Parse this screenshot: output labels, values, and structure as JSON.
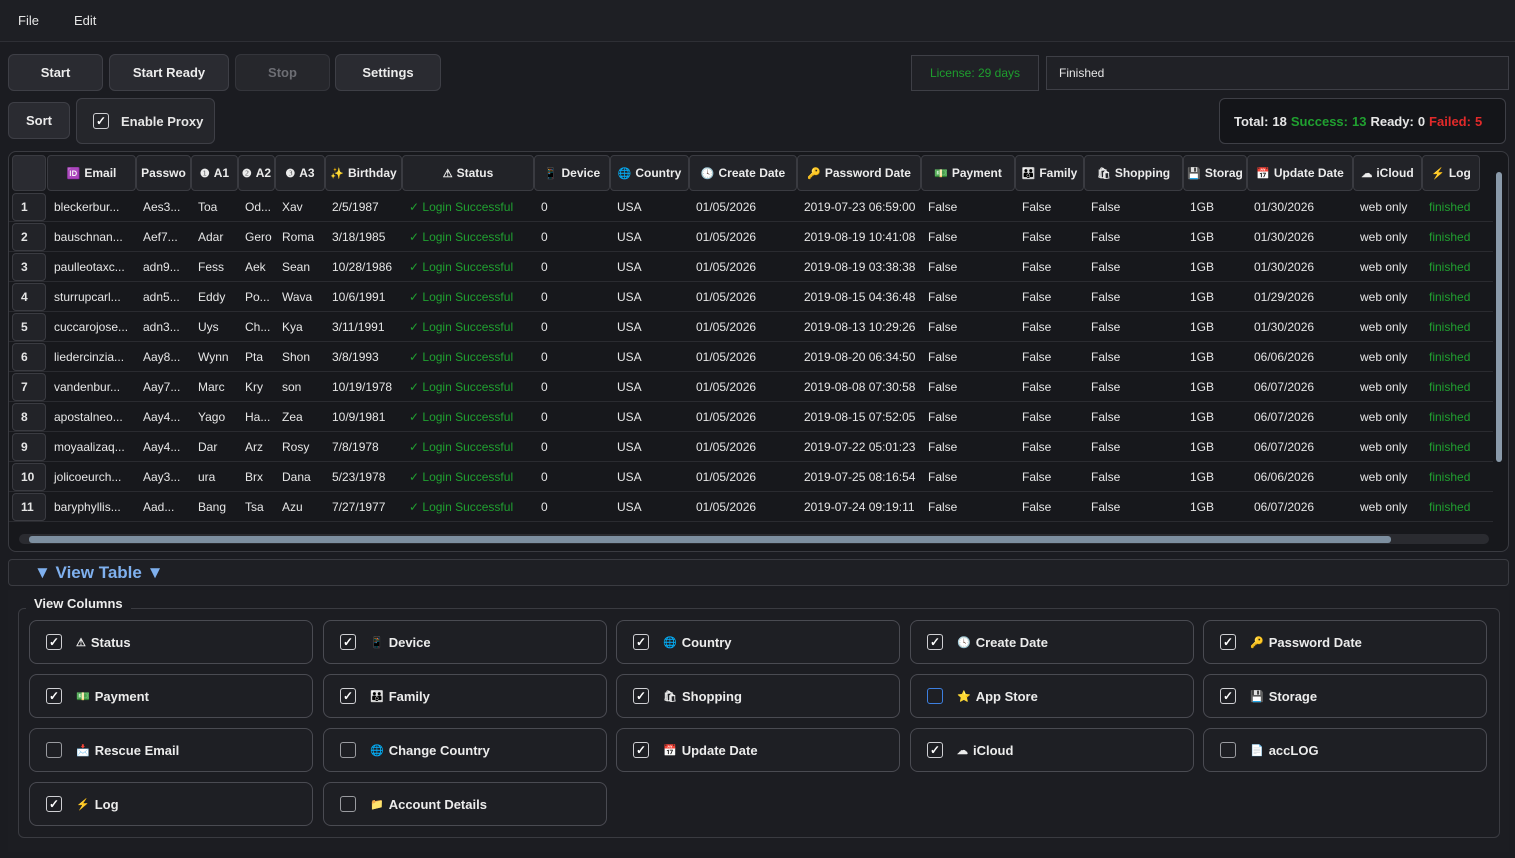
{
  "menu": [
    "File",
    "Edit"
  ],
  "buttons": {
    "start": "Start",
    "start_ready": "Start Ready",
    "stop": "Stop",
    "settings": "Settings",
    "sort": "Sort"
  },
  "license": "License: 29 days",
  "status_text": "Finished",
  "proxy": {
    "label": "Enable Proxy",
    "checked": true
  },
  "totals": {
    "total_label": "Total:",
    "total": "18",
    "success_label": "Success:",
    "success": "13",
    "ready_label": "Ready:",
    "ready": "0",
    "failed_label": "Failed:",
    "failed": "5"
  },
  "table": {
    "headers": [
      {
        "label": "Email",
        "icon": "🆔"
      },
      {
        "label": "Passwo",
        "icon": ""
      },
      {
        "label": "A1",
        "icon": "❶"
      },
      {
        "label": "A2",
        "icon": "❷"
      },
      {
        "label": "A3",
        "icon": "❸"
      },
      {
        "label": "Birthday",
        "icon": "✨"
      },
      {
        "label": "Status",
        "icon": "⚠"
      },
      {
        "label": "Device",
        "icon": "📱"
      },
      {
        "label": "Country",
        "icon": "🌐"
      },
      {
        "label": "Create Date",
        "icon": "🕓"
      },
      {
        "label": "Password Date",
        "icon": "🔑"
      },
      {
        "label": "Payment",
        "icon": "💵"
      },
      {
        "label": "Family",
        "icon": "👪"
      },
      {
        "label": "Shopping",
        "icon": "🛍"
      },
      {
        "label": "Storag",
        "icon": "💾"
      },
      {
        "label": "Update Date",
        "icon": "📅"
      },
      {
        "label": "iCloud",
        "icon": "☁"
      },
      {
        "label": "Log",
        "icon": "⚡"
      }
    ],
    "rows": [
      {
        "n": "1",
        "cells": [
          "bleckerbur...",
          "Aes3...",
          "Toa",
          "Od...",
          "Xav",
          "2/5/1987",
          "✓ Login Successful",
          "0",
          "USA",
          "01/05/2026",
          "2019-07-23 06:59:00",
          "False",
          "False",
          "False",
          "1GB",
          "01/30/2026",
          "web only",
          "finished"
        ]
      },
      {
        "n": "2",
        "cells": [
          "bauschnan...",
          "Aef7...",
          "Adar",
          "Gero",
          "Roma",
          "3/18/1985",
          "✓ Login Successful",
          "0",
          "USA",
          "01/05/2026",
          "2019-08-19 10:41:08",
          "False",
          "False",
          "False",
          "1GB",
          "01/30/2026",
          "web only",
          "finished"
        ]
      },
      {
        "n": "3",
        "cells": [
          "paulleotaxc...",
          "adn9...",
          "Fess",
          "Aek",
          "Sean",
          "10/28/1986",
          "✓ Login Successful",
          "0",
          "USA",
          "01/05/2026",
          "2019-08-19 03:38:38",
          "False",
          "False",
          "False",
          "1GB",
          "01/30/2026",
          "web only",
          "finished"
        ]
      },
      {
        "n": "4",
        "cells": [
          "sturrupcarl...",
          "adn5...",
          "Eddy",
          "Po...",
          "Wava",
          "10/6/1991",
          "✓ Login Successful",
          "0",
          "USA",
          "01/05/2026",
          "2019-08-15 04:36:48",
          "False",
          "False",
          "False",
          "1GB",
          "01/29/2026",
          "web only",
          "finished"
        ]
      },
      {
        "n": "5",
        "cells": [
          "cuccarojose...",
          "adn3...",
          "Uys",
          "Ch...",
          "Kya",
          "3/11/1991",
          "✓ Login Successful",
          "0",
          "USA",
          "01/05/2026",
          "2019-08-13 10:29:26",
          "False",
          "False",
          "False",
          "1GB",
          "01/30/2026",
          "web only",
          "finished"
        ]
      },
      {
        "n": "6",
        "cells": [
          "liedercinzia...",
          "Aay8...",
          "Wynn",
          "Pta",
          "Shon",
          "3/8/1993",
          "✓ Login Successful",
          "0",
          "USA",
          "01/05/2026",
          "2019-08-20 06:34:50",
          "False",
          "False",
          "False",
          "1GB",
          "06/06/2026",
          "web only",
          "finished"
        ]
      },
      {
        "n": "7",
        "cells": [
          "vandenbur...",
          "Aay7...",
          "Marc",
          "Kry",
          "son",
          "10/19/1978",
          "✓ Login Successful",
          "0",
          "USA",
          "01/05/2026",
          "2019-08-08 07:30:58",
          "False",
          "False",
          "False",
          "1GB",
          "06/07/2026",
          "web only",
          "finished"
        ]
      },
      {
        "n": "8",
        "cells": [
          "apostalneo...",
          "Aay4...",
          "Yago",
          "Ha...",
          "Zea",
          "10/9/1981",
          "✓ Login Successful",
          "0",
          "USA",
          "01/05/2026",
          "2019-08-15 07:52:05",
          "False",
          "False",
          "False",
          "1GB",
          "06/07/2026",
          "web only",
          "finished"
        ]
      },
      {
        "n": "9",
        "cells": [
          "moyaalizaq...",
          "Aay4...",
          "Dar",
          "Arz",
          "Rosy",
          "7/8/1978",
          "✓ Login Successful",
          "0",
          "USA",
          "01/05/2026",
          "2019-07-22 05:01:23",
          "False",
          "False",
          "False",
          "1GB",
          "06/07/2026",
          "web only",
          "finished"
        ]
      },
      {
        "n": "10",
        "cells": [
          "jolicoeurch...",
          "Aay3...",
          "ura",
          "Brx",
          "Dana",
          "5/23/1978",
          "✓ Login Successful",
          "0",
          "USA",
          "01/05/2026",
          "2019-07-25 08:16:54",
          "False",
          "False",
          "False",
          "1GB",
          "06/06/2026",
          "web only",
          "finished"
        ]
      },
      {
        "n": "11",
        "cells": [
          "baryphyllis...",
          "Aad...",
          "Bang",
          "Tsa",
          "Azu",
          "7/27/1977",
          "✓ Login Successful",
          "0",
          "USA",
          "01/05/2026",
          "2019-07-24 09:19:11",
          "False",
          "False",
          "False",
          "1GB",
          "06/07/2026",
          "web only",
          "finished"
        ]
      }
    ]
  },
  "view_table_label": "▼ View Table ▼",
  "view_columns": {
    "title": "View Columns",
    "options": [
      {
        "label": "Status",
        "icon": "⚠",
        "checked": true
      },
      {
        "label": "Device",
        "icon": "📱",
        "checked": true
      },
      {
        "label": "Country",
        "icon": "🌐",
        "checked": true
      },
      {
        "label": "Create Date",
        "icon": "🕓",
        "checked": true
      },
      {
        "label": "Password Date",
        "icon": "🔑",
        "checked": true
      },
      {
        "label": "Payment",
        "icon": "💵",
        "checked": true
      },
      {
        "label": "Family",
        "icon": "👪",
        "checked": true
      },
      {
        "label": "Shopping",
        "icon": "🛍",
        "checked": true
      },
      {
        "label": "App Store",
        "icon": "⭐",
        "checked": false
      },
      {
        "label": "Storage",
        "icon": "💾",
        "checked": true
      },
      {
        "label": "Rescue Email",
        "icon": "📩",
        "checked": false
      },
      {
        "label": "Change Country",
        "icon": "🌐",
        "checked": false
      },
      {
        "label": "Update Date",
        "icon": "📅",
        "checked": true
      },
      {
        "label": "iCloud",
        "icon": "☁",
        "checked": true
      },
      {
        "label": "accLOG",
        "icon": "📄",
        "checked": false
      },
      {
        "label": "Log",
        "icon": "⚡",
        "checked": true
      },
      {
        "label": "Account Details",
        "icon": "📁",
        "checked": false
      }
    ]
  }
}
